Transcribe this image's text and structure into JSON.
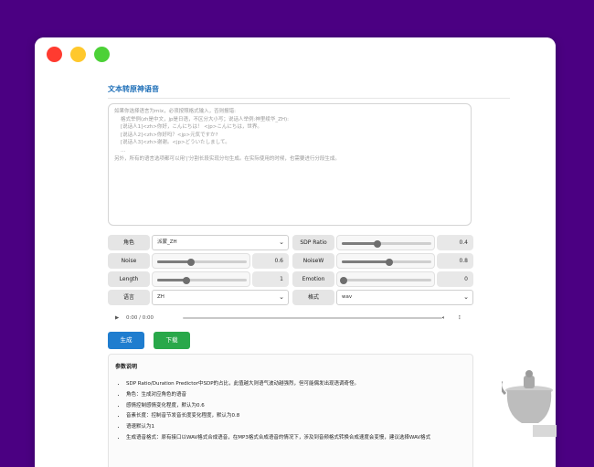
{
  "window": {
    "traffic_lights": {
      "close": "#ff3b30",
      "minimize": "#ffc82c",
      "maximize": "#4cd137"
    }
  },
  "page": {
    "title": "文本转原神语音",
    "textarea_placeholder": "如果你选择语言为mix，必须按照格式输入，否则报错:\n    格式举例(zh是中文，jp是日语，不区分大小写；说话人举例:神里绫华_ZH):\n    [说话人1]<zh>你好，こんにちは！ <jp>こんにちは，世界。\n    [说话人2]<zh>你好吗？<jp>元気ですか?\n    [说话人3]<zh>谢谢。<jp>どういたしまして。\n    ...\n另外，所有的语言选项都可以用'|'分割长段实现分句生成。在实际使用的时候，也需要进行分段生成。"
  },
  "controls": {
    "speaker": {
      "label": "角色",
      "value": "派蒙_ZH"
    },
    "sdp_ratio": {
      "label": "SDP Ratio",
      "value": "0.4",
      "fraction": 0.4
    },
    "noise": {
      "label": "Noise",
      "value": "0.6",
      "fraction": 0.6
    },
    "noisew": {
      "label": "NoiseW",
      "value": "0.8",
      "fraction": 0.8
    },
    "length": {
      "label": "Length",
      "value": "1",
      "fraction": 0.33
    },
    "emotion": {
      "label": "Emotion",
      "value": "0",
      "fraction": 0.0
    },
    "language": {
      "label": "语言",
      "value": "ZH"
    },
    "format": {
      "label": "格式",
      "value": "wav"
    }
  },
  "audio": {
    "time": "0:00 / 0:00"
  },
  "buttons": {
    "generate": "生成",
    "download": "下载"
  },
  "params": {
    "title": "参数说明",
    "items": [
      "SDP Ratio/Duration Predictor中SDP的占比，此值越大则语气波动越强烈，但可能偶发出现语调奇怪。",
      "角色：生成对应角色的语音",
      "感情控制感情变化程度，默认为0.6",
      "音素长度：控制音节发音长度变化程度，默认为0.8",
      "语速默认为1",
      "生成语音格式：原有接口以WAV格式合成语音，在MP3格式合成语音的情况下，涉及到音频格式转换合成速度会变慢，建议选择WAV格式"
    ]
  }
}
